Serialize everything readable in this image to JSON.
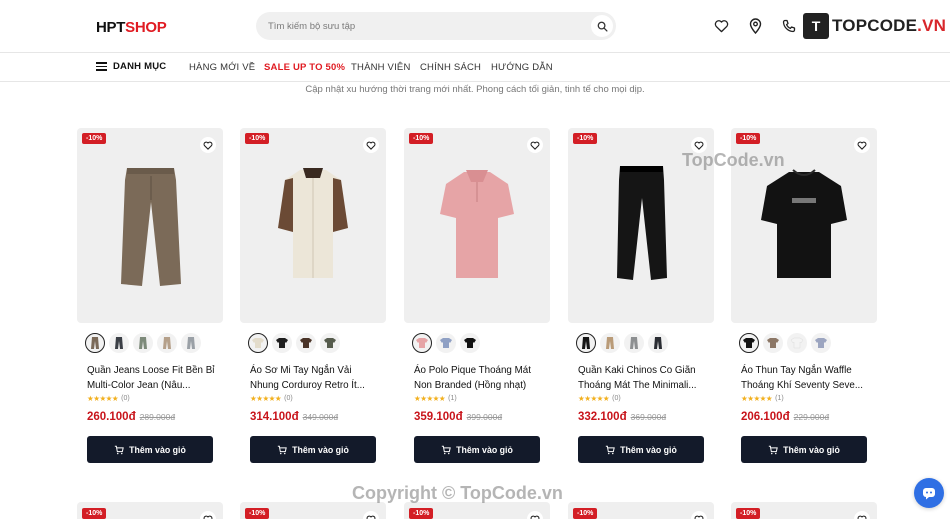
{
  "header": {
    "logo_part1": "HPT",
    "logo_part2": "SHOP",
    "search_placeholder": "Tìm kiếm bộ sưu tập",
    "icons": [
      "search-icon",
      "heart-icon",
      "location-pin-icon",
      "phone-icon"
    ],
    "watermark_logo": {
      "badge": "T",
      "text_main": "TOPCODE",
      "text_accent": ".VN"
    }
  },
  "nav": {
    "category": "DANH MỤC",
    "items": [
      "HÀNG MỚI VỀ",
      "SALE UP TO 50%",
      "THÀNH VIÊN",
      "CHÍNH SÁCH",
      "HƯỚNG DẪN"
    ]
  },
  "subtitle": "Cập nhật xu hướng thời trang mới nhất. Phong cách tối giản, tinh tế cho mọi dịp.",
  "colors": {
    "sale": "#e01b22",
    "price": "#c8141b",
    "button": "#131a2a",
    "badge": "#d31e25",
    "star": "#f2b01e"
  },
  "products": [
    {
      "badge": "-10%",
      "name": "Quần Jeans Loose Fit Bền Bỉ Multi-Color Jean (Nâu...",
      "rating_count": "(0)",
      "price": "260.100đ",
      "old_price": "289.000đ",
      "button": "Thêm vào giỏ",
      "swatch_count": 5
    },
    {
      "badge": "-10%",
      "name": "Áo Sơ Mi Tay Ngắn Vải Nhung Corduroy Retro Ít...",
      "rating_count": "(0)",
      "price": "314.100đ",
      "old_price": "349.000đ",
      "button": "Thêm vào giỏ",
      "swatch_count": 4
    },
    {
      "badge": "-10%",
      "name": "Áo Polo Pique Thoáng Mát Non Branded (Hồng nhạt)",
      "rating_count": "(1)",
      "price": "359.100đ",
      "old_price": "399.000đ",
      "button": "Thêm vào giỏ",
      "swatch_count": 3
    },
    {
      "badge": "-10%",
      "name": "Quần Kaki Chinos Co Giãn Thoáng Mát The Minimali...",
      "rating_count": "(0)",
      "price": "332.100đ",
      "old_price": "369.000đ",
      "button": "Thêm vào giỏ",
      "swatch_count": 4
    },
    {
      "badge": "-10%",
      "name": "Áo Thun Tay Ngắn Waffle Thoáng Khí Seventy Seve...",
      "rating_count": "(1)",
      "price": "206.100đ",
      "old_price": "229.000đ",
      "button": "Thêm vào giỏ",
      "swatch_count": 4
    }
  ],
  "row2_badges": [
    "-10%",
    "-10%",
    "-10%",
    "-10%",
    "-10%"
  ],
  "watermarks": {
    "top": "TopCode.vn",
    "bottom": "Copyright © TopCode.vn"
  }
}
